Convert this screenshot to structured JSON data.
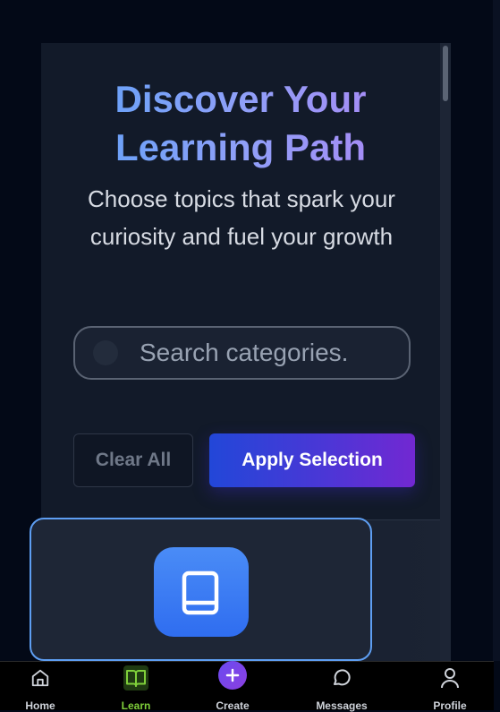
{
  "hero": {
    "title": "Discover Your Learning Path",
    "subtitle": "Choose topics that spark your curiosity and fuel your growth"
  },
  "search": {
    "placeholder": "Search categories..."
  },
  "actions": {
    "clear_label": "Clear All",
    "apply_label": "Apply Selection"
  },
  "category_card": {
    "icon": "book-icon"
  },
  "nav": {
    "items": [
      {
        "label": "Home",
        "icon": "home-icon"
      },
      {
        "label": "Learn",
        "icon": "book-open-icon",
        "active": true
      },
      {
        "label": "Create",
        "icon": "plus-icon"
      },
      {
        "label": "Messages",
        "icon": "chat-bubble-icon"
      },
      {
        "label": "Profile",
        "icon": "user-icon"
      }
    ]
  },
  "colors": {
    "background": "#030917",
    "panel": "#121a29",
    "accent_blue": "#2247d8",
    "accent_purple": "#7228d2",
    "active_nav": "#7fcf3a",
    "card_border": "#5e9ef2"
  }
}
